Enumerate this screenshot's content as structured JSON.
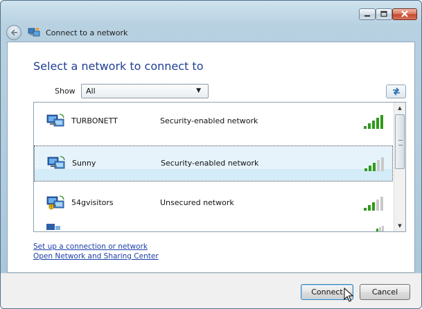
{
  "window": {
    "title": "Connect to a network"
  },
  "main": {
    "heading": "Select a network to connect to",
    "show": {
      "label": "Show",
      "selected": "All"
    }
  },
  "networks": [
    {
      "name": "TURBONETT",
      "security": "Security-enabled network",
      "signal_bars": 5,
      "selected": false,
      "shield": false
    },
    {
      "name": "Sunny",
      "security": "Security-enabled network",
      "signal_bars": 3,
      "selected": true,
      "shield": false
    },
    {
      "name": "54gvisitors",
      "security": "Unsecured network",
      "signal_bars": 3,
      "selected": false,
      "shield": true
    }
  ],
  "links": {
    "setup": "Set up a connection or network",
    "sharing_center": "Open Network and Sharing Center"
  },
  "footer": {
    "connect_label": "Connect",
    "cancel_label": "Cancel"
  },
  "colors": {
    "heading": "#1f3f93",
    "link": "#1b3fa8",
    "signal_on": "#2f9a1b",
    "signal_off": "#c9c9c9",
    "selection": "#e6f3fb"
  }
}
